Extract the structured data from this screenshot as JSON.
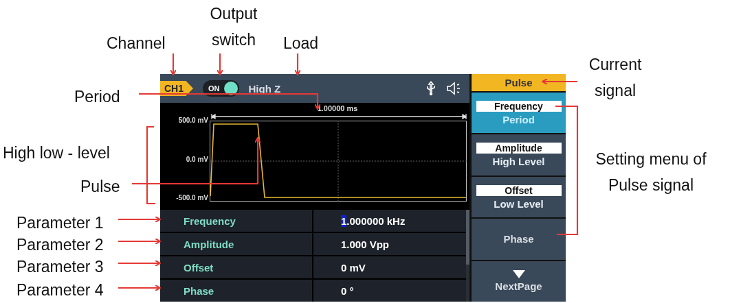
{
  "screen": {
    "top_bar": {
      "channel": "CH1",
      "output_switch": {
        "label": "ON",
        "on": true
      },
      "load": "High Z"
    },
    "waveform": {
      "period": "1.00000 ms",
      "y_labels": [
        "500.0 mV",
        "0.0 mV",
        "-500.0 mV"
      ]
    },
    "parameters": [
      {
        "name": "Frequency",
        "value": "1.000000 kHz",
        "cursor": true
      },
      {
        "name": "Amplitude",
        "value": "1.000 Vpp",
        "cursor": false
      },
      {
        "name": "Offset",
        "value": "0 mV",
        "cursor": false
      },
      {
        "name": "Phase",
        "value": "0 °",
        "cursor": false
      }
    ],
    "menu": {
      "title": "Pulse",
      "items": [
        {
          "kind": "pair",
          "top": "Frequency",
          "bottom": "Period",
          "selected": true
        },
        {
          "kind": "pair",
          "top": "Amplitude",
          "bottom": "High Level",
          "selected": false
        },
        {
          "kind": "pair",
          "top": "Offset",
          "bottom": "Low Level",
          "selected": false
        },
        {
          "kind": "single",
          "label": "Phase",
          "selected": false
        },
        {
          "kind": "next",
          "label": "NextPage",
          "selected": false
        }
      ]
    }
  },
  "annotations": [
    {
      "text": "Channel"
    },
    {
      "text": "Output switch"
    },
    {
      "text": "Load"
    },
    {
      "text": "Period"
    },
    {
      "text": "High low - level"
    },
    {
      "text": "Pulse"
    },
    {
      "text": "Parameter 1"
    },
    {
      "text": "Parameter 2"
    },
    {
      "text": "Parameter 3"
    },
    {
      "text": "Parameter 4"
    },
    {
      "text": "Current signal"
    },
    {
      "text": "Setting menu of Pulse signal"
    }
  ]
}
